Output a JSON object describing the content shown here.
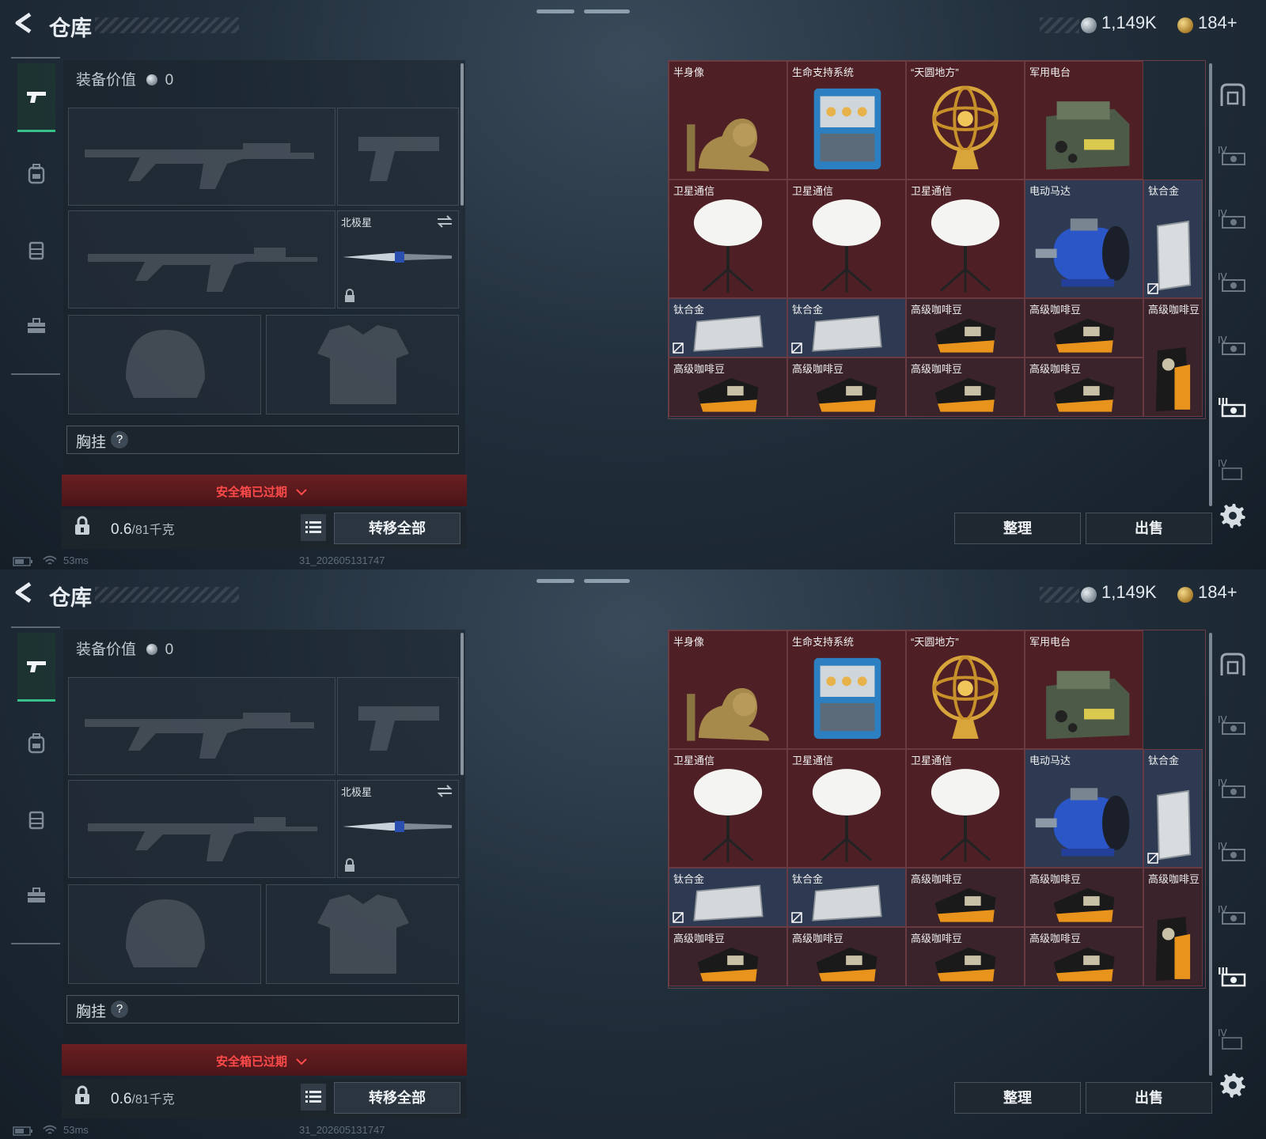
{
  "header": {
    "title": "仓库",
    "silver": "1,149K",
    "gold": "184+"
  },
  "equipment": {
    "value_label": "装备价值",
    "value": "0",
    "melee_label": "北极星",
    "chest_label": "胸挂",
    "chest_help": "?"
  },
  "safebox": {
    "expired": "安全箱已过期"
  },
  "bottom": {
    "weight_value": "0.6",
    "weight_total": "/81千克",
    "transfer_all": "转移全部"
  },
  "status": {
    "ping": "53ms",
    "build": "31_202605131747"
  },
  "grid_items": [
    {
      "label": "半身像",
      "icon": "bust-icon",
      "color": "red"
    },
    {
      "label": "生命支持系统",
      "icon": "life-support-icon",
      "color": "red"
    },
    {
      "label": "“天圆地方”",
      "icon": "armillary-sphere-icon",
      "color": "red"
    },
    {
      "label": "军用电台",
      "icon": "military-radio-icon",
      "color": "red"
    },
    {
      "label": "卫星通信",
      "icon": "satellite-dish-icon",
      "color": "red"
    },
    {
      "label": "卫星通信",
      "icon": "satellite-dish-icon",
      "color": "red"
    },
    {
      "label": "卫星通信",
      "icon": "satellite-dish-icon",
      "color": "red"
    },
    {
      "label": "电动马达",
      "icon": "electric-motor-icon",
      "color": "blue"
    },
    {
      "label": "钛合金",
      "icon": "titanium-bar-icon",
      "color": "blue"
    },
    {
      "label": "钛合金",
      "icon": "titanium-plate-icon",
      "color": "blue"
    },
    {
      "label": "钛合金",
      "icon": "titanium-plate-icon",
      "color": "blue"
    },
    {
      "label": "高级咖啡豆",
      "icon": "coffee-bag-icon",
      "color": "dark"
    },
    {
      "label": "高级咖啡豆",
      "icon": "coffee-bag-icon",
      "color": "dark"
    },
    {
      "label": "高级咖啡豆",
      "icon": "coffee-bag-upright-icon",
      "color": "dark"
    },
    {
      "label": "高级咖啡豆",
      "icon": "coffee-bag-icon",
      "color": "dark"
    },
    {
      "label": "高级咖啡豆",
      "icon": "coffee-bag-icon",
      "color": "dark"
    },
    {
      "label": "高级咖啡豆",
      "icon": "coffee-bag-icon",
      "color": "dark"
    },
    {
      "label": "高级咖啡豆",
      "icon": "coffee-bag-icon",
      "color": "dark"
    }
  ],
  "storage": {
    "tidy": "整理",
    "sell": "出售"
  },
  "colors": {
    "red_cell": "#4e2026",
    "blue_cell": "#2e3a52",
    "dark_cell": "#3a232a",
    "accent_green": "#38c08a",
    "warning_red": "#ff4b4b"
  }
}
